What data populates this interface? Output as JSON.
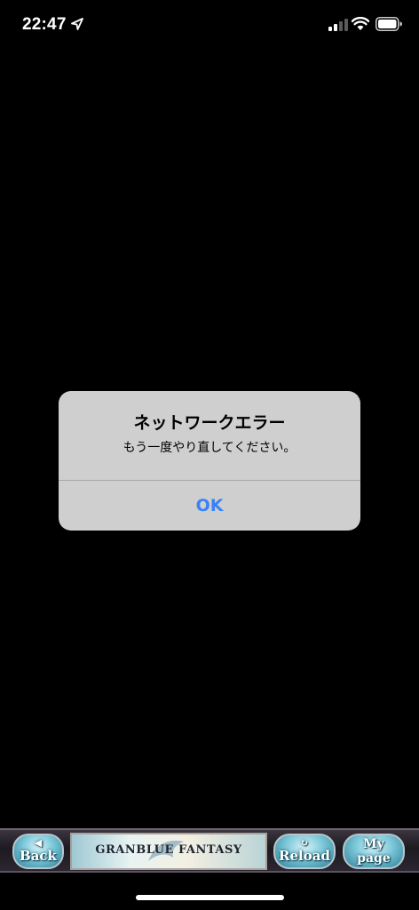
{
  "status_bar": {
    "time": "22:47",
    "icons": [
      "location-arrow-icon",
      "cellular-signal-icon",
      "wifi-icon",
      "battery-icon"
    ]
  },
  "alert": {
    "title": "ネットワークエラー",
    "message": "もう一度やり直してください。",
    "ok_label": "OK",
    "ok_color": "#3a82f7"
  },
  "game_nav": {
    "back_glyph": "◀",
    "back_label": "Back",
    "banner_text": "GRANBLUE FANTASY",
    "reload_glyph": "↻",
    "reload_label": "Reload",
    "mypage_label_line1": "My",
    "mypage_label_line2": "page"
  }
}
